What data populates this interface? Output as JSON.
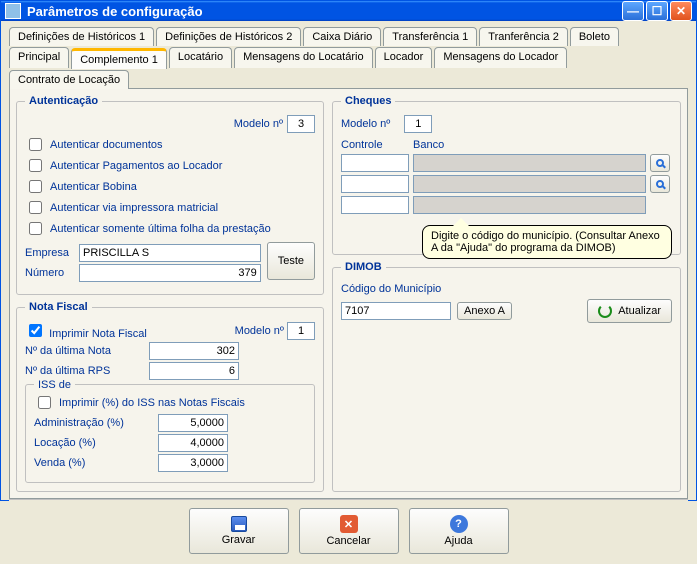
{
  "window": {
    "title": "Parâmetros de configuração"
  },
  "tabs_row1": [
    {
      "label": "Definições de Históricos 1"
    },
    {
      "label": "Definições de Históricos 2"
    },
    {
      "label": "Caixa Diário"
    },
    {
      "label": "Transferência 1"
    },
    {
      "label": "Tranferência 2"
    },
    {
      "label": "Boleto"
    }
  ],
  "tabs_row2": [
    {
      "label": "Principal"
    },
    {
      "label": "Complemento 1",
      "active": true
    },
    {
      "label": "Locatário"
    },
    {
      "label": "Mensagens do Locatário"
    },
    {
      "label": "Locador"
    },
    {
      "label": "Mensagens do Locador"
    },
    {
      "label": "Contrato de Locação"
    }
  ],
  "auth": {
    "legend": "Autenticação",
    "modelo_label": "Modelo nº",
    "modelo_value": "3",
    "c1": "Autenticar documentos",
    "c2": "Autenticar Pagamentos ao Locador",
    "c3": "Autenticar Bobina",
    "c4": "Autenticar via impressora matricial",
    "c5": "Autenticar somente última folha da prestação",
    "empresa_label": "Empresa",
    "empresa_value": "PRISCILLA S",
    "numero_label": "Número",
    "numero_value": "379",
    "teste_btn": "Teste"
  },
  "nf": {
    "legend": "Nota Fiscal",
    "imprimir": "Imprimir Nota Fiscal",
    "modelo_label": "Modelo nº",
    "modelo_value": "1",
    "ultima_nota_label": "Nº da última Nota",
    "ultima_nota_value": "302",
    "ultima_rps_label": "Nº da última RPS",
    "ultima_rps_value": "6",
    "iss_legend": "ISS de",
    "iss_chk": "Imprimir (%) do ISS nas Notas Fiscais",
    "adm_label": "Administração (%)",
    "adm_value": "5,0000",
    "loc_label": "Locação (%)",
    "loc_value": "4,0000",
    "ven_label": "Venda (%)",
    "ven_value": "3,0000"
  },
  "cheques": {
    "legend": "Cheques",
    "modelo_label": "Modelo nº",
    "modelo_value": "1",
    "controle_head": "Controle",
    "banco_head": "Banco"
  },
  "dimob": {
    "legend": "DIMOB",
    "codigo_label": "Código do Município",
    "codigo_value": "7107",
    "anexo_btn": "Anexo A",
    "atualizar_btn": "Atualizar",
    "tooltip": "Digite o código do município. (Consultar Anexo A da \"Ajuda\" do programa da DIMOB)"
  },
  "footer": {
    "gravar": "Gravar",
    "cancelar": "Cancelar",
    "ajuda": "Ajuda"
  }
}
